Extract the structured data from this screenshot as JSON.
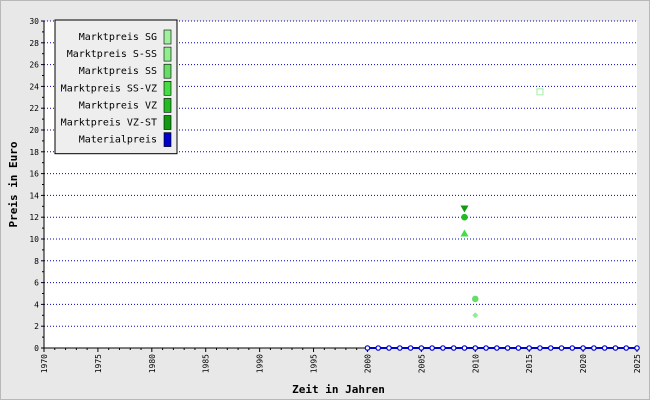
{
  "chart_data": {
    "type": "scatter",
    "xlabel": "Zeit in Jahren",
    "ylabel": "Preis in Euro",
    "xlim": [
      1970,
      2025
    ],
    "ylim": [
      0,
      30
    ],
    "x_ticks": [
      1970,
      1975,
      1980,
      1985,
      1990,
      1995,
      2000,
      2005,
      2010,
      2015,
      2020,
      2025
    ],
    "y_ticks": [
      0,
      2,
      4,
      6,
      8,
      10,
      12,
      14,
      16,
      18,
      20,
      22,
      24,
      26,
      28,
      30
    ],
    "grid": "horizontal dotted",
    "legend_position": "top-left",
    "series": [
      {
        "name": "Marktpreis SG",
        "color": "#a0f0a0",
        "marker": "square-open",
        "points": [
          [
            2016,
            23.5
          ]
        ]
      },
      {
        "name": "Marktpreis S-SS",
        "color": "#90ee90",
        "marker": "diamond",
        "points": [
          [
            2010,
            3.0
          ]
        ]
      },
      {
        "name": "Marktpreis SS",
        "color": "#66dd66",
        "marker": "circle",
        "points": [
          [
            2010,
            4.5
          ]
        ]
      },
      {
        "name": "Marktpreis SS-VZ",
        "color": "#44dd44",
        "marker": "triangle-up",
        "points": [
          [
            2009,
            10.5
          ]
        ]
      },
      {
        "name": "Marktpreis VZ",
        "color": "#22bb22",
        "marker": "circle",
        "points": [
          [
            2009,
            12.0
          ]
        ]
      },
      {
        "name": "Marktpreis VZ-ST",
        "color": "#119911",
        "marker": "triangle-down",
        "points": [
          [
            2009,
            12.8
          ]
        ]
      },
      {
        "name": "Materialpreis",
        "color": "#0000cc",
        "marker": "circle-line",
        "points": [
          [
            2000,
            0
          ],
          [
            2001,
            0
          ],
          [
            2002,
            0
          ],
          [
            2003,
            0
          ],
          [
            2004,
            0
          ],
          [
            2005,
            0
          ],
          [
            2006,
            0
          ],
          [
            2007,
            0
          ],
          [
            2008,
            0
          ],
          [
            2009,
            0
          ],
          [
            2010,
            0
          ],
          [
            2011,
            0
          ],
          [
            2012,
            0
          ],
          [
            2013,
            0
          ],
          [
            2014,
            0
          ],
          [
            2015,
            0
          ],
          [
            2016,
            0
          ],
          [
            2017,
            0
          ],
          [
            2018,
            0
          ],
          [
            2019,
            0
          ],
          [
            2020,
            0
          ],
          [
            2021,
            0
          ],
          [
            2022,
            0
          ],
          [
            2023,
            0
          ],
          [
            2024,
            0
          ],
          [
            2025,
            0
          ]
        ]
      }
    ]
  }
}
